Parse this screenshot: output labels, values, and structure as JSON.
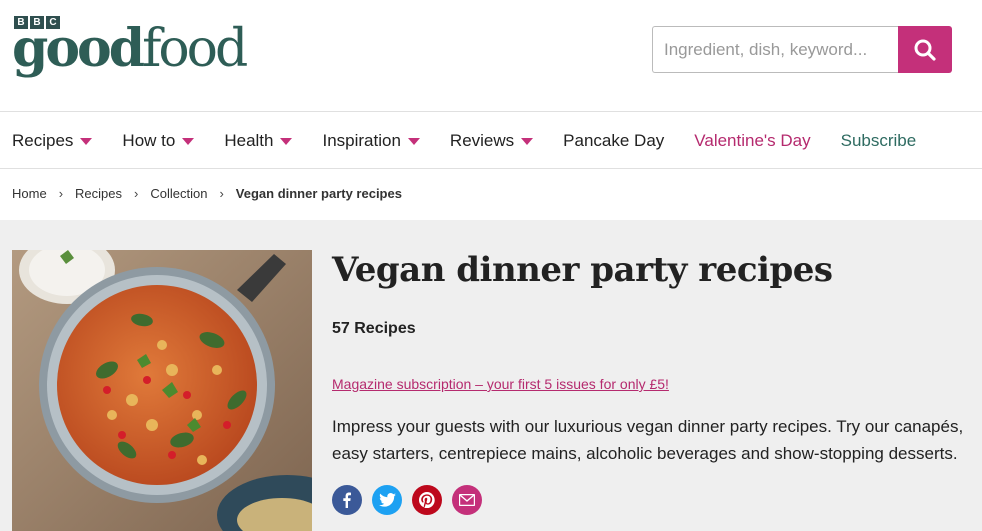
{
  "logo": {
    "badge": [
      "B",
      "B",
      "C"
    ],
    "word_bold": "good",
    "word_light": "food"
  },
  "search": {
    "placeholder": "Ingredient, dish, keyword...",
    "value": ""
  },
  "nav": [
    {
      "label": "Recipes",
      "dropdown": true
    },
    {
      "label": "How to",
      "dropdown": true
    },
    {
      "label": "Health",
      "dropdown": true
    },
    {
      "label": "Inspiration",
      "dropdown": true
    },
    {
      "label": "Reviews",
      "dropdown": true
    },
    {
      "label": "Pancake Day",
      "dropdown": false
    },
    {
      "label": "Valentine's Day",
      "dropdown": false
    },
    {
      "label": "Subscribe",
      "dropdown": false
    }
  ],
  "breadcrumb": {
    "home": "Home",
    "recipes": "Recipes",
    "collection": "Collection",
    "current": "Vegan dinner party recipes",
    "separator": "›"
  },
  "hero": {
    "title": "Vegan dinner party recipes",
    "count": "57 Recipes",
    "promo": "Magazine subscription – your first 5 issues for only £5!",
    "description": "Impress your guests with our luxurious vegan dinner party recipes. Try our canapés, easy starters, centrepiece mains, alcoholic beverages and show-stopping desserts."
  },
  "social": [
    {
      "name": "facebook-icon",
      "color": "#3b5998"
    },
    {
      "name": "twitter-icon",
      "color": "#1da1f2"
    },
    {
      "name": "pinterest-icon",
      "color": "#bd081c"
    },
    {
      "name": "email-icon",
      "color": "#c4307a"
    }
  ],
  "colors": {
    "brand_pink": "#c4307a",
    "brand_teal": "#2e5d56",
    "hero_bg": "#efefef"
  }
}
